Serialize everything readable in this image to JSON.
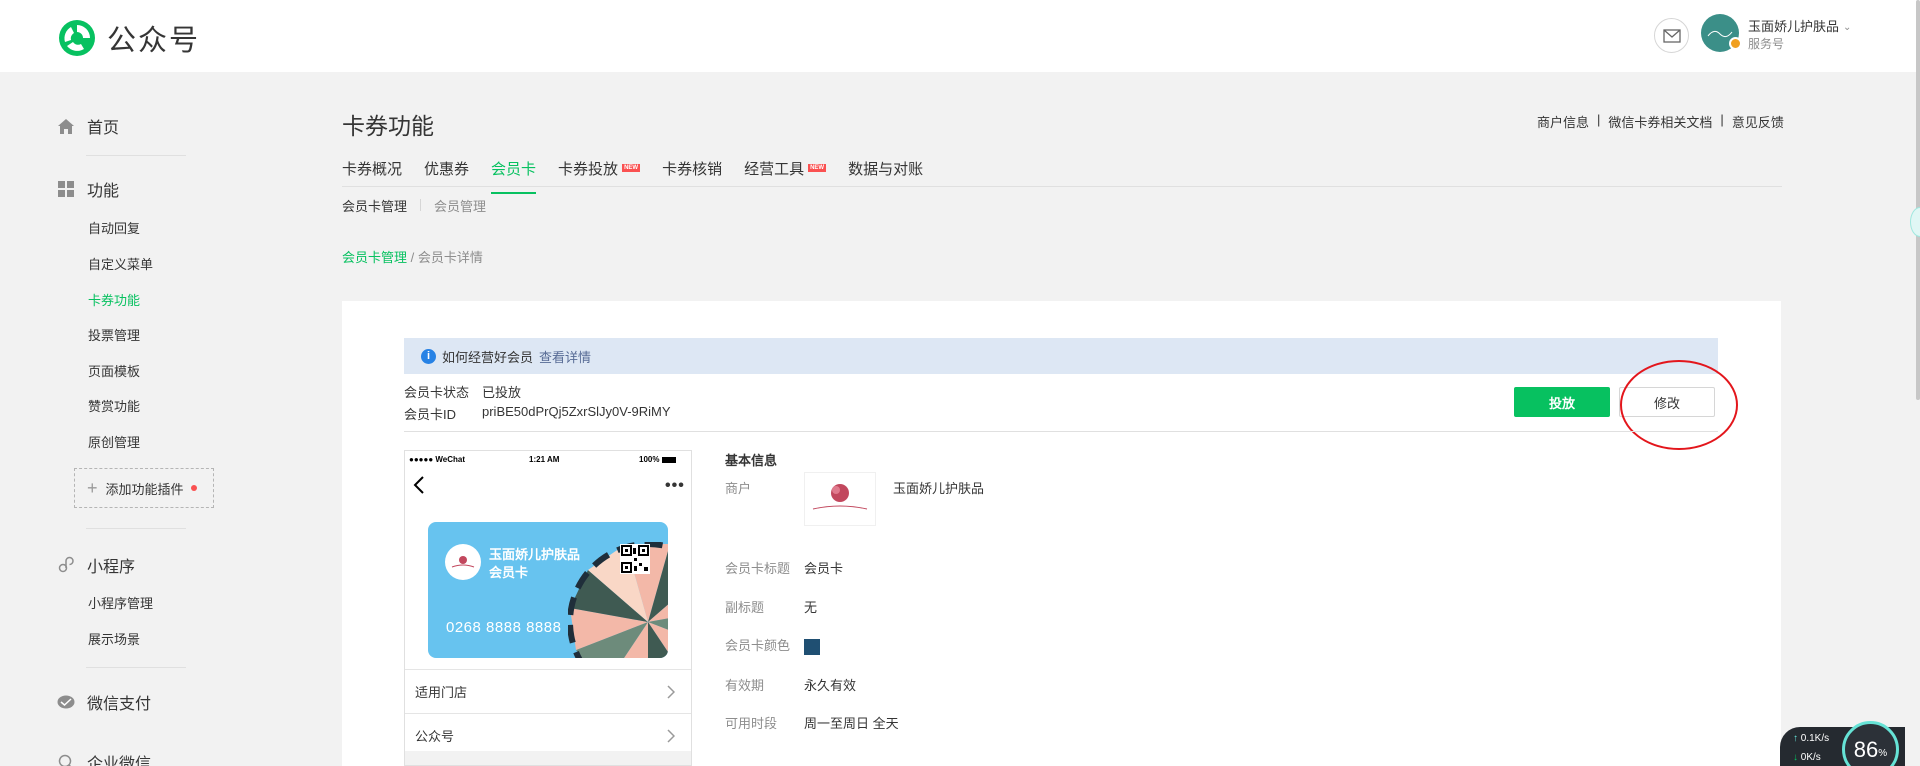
{
  "header": {
    "logo_text": "公众号",
    "account_name": "玉面娇儿护肤品",
    "account_type": "服务号"
  },
  "sidebar": {
    "groups": [
      {
        "label": "首页",
        "icon": "home-icon"
      },
      {
        "label": "功能",
        "icon": "grid-icon",
        "items": [
          "自动回复",
          "自定义菜单",
          "卡券功能",
          "投票管理",
          "页面模板",
          "赞赏功能",
          "原创管理"
        ]
      },
      {
        "label": "小程序",
        "icon": "link-icon",
        "items": [
          "小程序管理",
          "展示场景"
        ]
      },
      {
        "label": "微信支付",
        "icon": "wechat-pay-icon"
      },
      {
        "label": "企业微信",
        "icon": "search-icon"
      }
    ],
    "active_item": "卡券功能",
    "plugin_button": "添加功能插件"
  },
  "main": {
    "title": "卡券功能",
    "top_links": [
      "商户信息",
      "微信卡券相关文档",
      "意见反馈"
    ],
    "tabs": [
      {
        "label": "卡券概况"
      },
      {
        "label": "优惠券"
      },
      {
        "label": "会员卡",
        "active": true
      },
      {
        "label": "卡券投放",
        "new": true
      },
      {
        "label": "卡券核销"
      },
      {
        "label": "经营工具",
        "new": true
      },
      {
        "label": "数据与对账"
      }
    ],
    "new_tag": "NEW",
    "subtabs": [
      "会员卡管理",
      "会员管理"
    ],
    "breadcrumb": {
      "link": "会员卡管理",
      "sep": " / ",
      "current": "会员卡详情"
    }
  },
  "panel": {
    "tip": {
      "text": "如何经营好会员",
      "link": "查看详情"
    },
    "status_label": "会员卡状态",
    "status_value": "已投放",
    "id_label": "会员卡ID",
    "id_value": "priBE50dPrQj5ZxrSlJy0V-9RiMY",
    "publish_button": "投放",
    "edit_button": "修改"
  },
  "preview": {
    "status_left": "●●●●● WeChat",
    "status_time": "1:21 AM",
    "status_battery": "100%",
    "card_merchant": "玉面娇儿护肤品",
    "card_title": "会员卡",
    "card_number": "0268 8888 8888",
    "rows": [
      "适用门店",
      "公众号"
    ]
  },
  "info": {
    "title": "基本信息",
    "merchant_label": "商户",
    "merchant_value": "玉面娇儿护肤品",
    "card_title_label": "会员卡标题",
    "card_title_value": "会员卡",
    "subtitle_label": "副标题",
    "subtitle_value": "无",
    "color_label": "会员卡颜色",
    "color_value": "#1f4f72",
    "validity_label": "有效期",
    "validity_value": "永久有效",
    "time_label": "可用时段",
    "time_value": "周一至周日 全天"
  },
  "widgets": {
    "up_speed": "0.1K/s",
    "down_speed": "0K/s",
    "percent": "86",
    "percent_unit": "%"
  },
  "colors": {
    "accent": "#07c160",
    "link": "#576b95",
    "tip_bg": "#dde7f4"
  }
}
